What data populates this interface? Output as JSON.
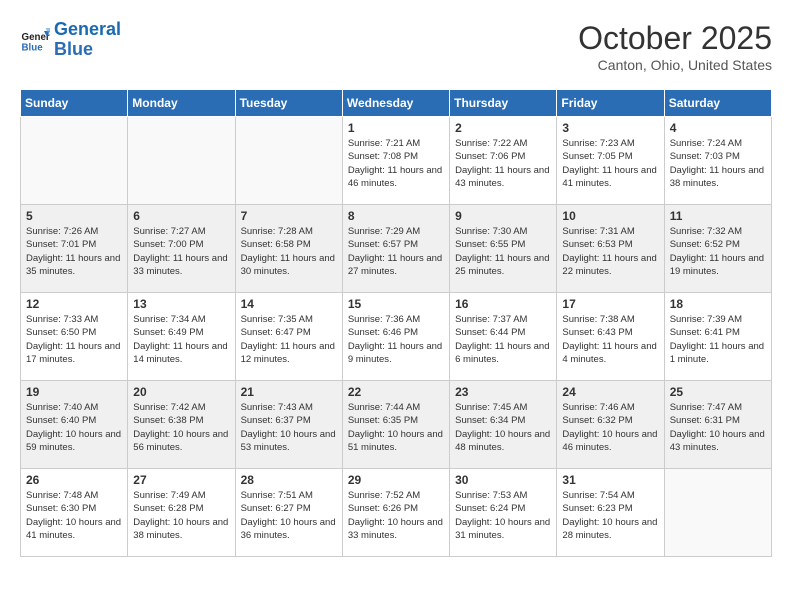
{
  "header": {
    "logo_line1": "General",
    "logo_line2": "Blue",
    "month": "October 2025",
    "location": "Canton, Ohio, United States"
  },
  "days_of_week": [
    "Sunday",
    "Monday",
    "Tuesday",
    "Wednesday",
    "Thursday",
    "Friday",
    "Saturday"
  ],
  "weeks": [
    [
      {
        "day": "",
        "empty": true
      },
      {
        "day": "",
        "empty": true
      },
      {
        "day": "",
        "empty": true
      },
      {
        "day": "1",
        "sunrise": "7:21 AM",
        "sunset": "7:08 PM",
        "daylight": "11 hours and 46 minutes."
      },
      {
        "day": "2",
        "sunrise": "7:22 AM",
        "sunset": "7:06 PM",
        "daylight": "11 hours and 43 minutes."
      },
      {
        "day": "3",
        "sunrise": "7:23 AM",
        "sunset": "7:05 PM",
        "daylight": "11 hours and 41 minutes."
      },
      {
        "day": "4",
        "sunrise": "7:24 AM",
        "sunset": "7:03 PM",
        "daylight": "11 hours and 38 minutes."
      }
    ],
    [
      {
        "day": "5",
        "sunrise": "7:26 AM",
        "sunset": "7:01 PM",
        "daylight": "11 hours and 35 minutes."
      },
      {
        "day": "6",
        "sunrise": "7:27 AM",
        "sunset": "7:00 PM",
        "daylight": "11 hours and 33 minutes."
      },
      {
        "day": "7",
        "sunrise": "7:28 AM",
        "sunset": "6:58 PM",
        "daylight": "11 hours and 30 minutes."
      },
      {
        "day": "8",
        "sunrise": "7:29 AM",
        "sunset": "6:57 PM",
        "daylight": "11 hours and 27 minutes."
      },
      {
        "day": "9",
        "sunrise": "7:30 AM",
        "sunset": "6:55 PM",
        "daylight": "11 hours and 25 minutes."
      },
      {
        "day": "10",
        "sunrise": "7:31 AM",
        "sunset": "6:53 PM",
        "daylight": "11 hours and 22 minutes."
      },
      {
        "day": "11",
        "sunrise": "7:32 AM",
        "sunset": "6:52 PM",
        "daylight": "11 hours and 19 minutes."
      }
    ],
    [
      {
        "day": "12",
        "sunrise": "7:33 AM",
        "sunset": "6:50 PM",
        "daylight": "11 hours and 17 minutes."
      },
      {
        "day": "13",
        "sunrise": "7:34 AM",
        "sunset": "6:49 PM",
        "daylight": "11 hours and 14 minutes."
      },
      {
        "day": "14",
        "sunrise": "7:35 AM",
        "sunset": "6:47 PM",
        "daylight": "11 hours and 12 minutes."
      },
      {
        "day": "15",
        "sunrise": "7:36 AM",
        "sunset": "6:46 PM",
        "daylight": "11 hours and 9 minutes."
      },
      {
        "day": "16",
        "sunrise": "7:37 AM",
        "sunset": "6:44 PM",
        "daylight": "11 hours and 6 minutes."
      },
      {
        "day": "17",
        "sunrise": "7:38 AM",
        "sunset": "6:43 PM",
        "daylight": "11 hours and 4 minutes."
      },
      {
        "day": "18",
        "sunrise": "7:39 AM",
        "sunset": "6:41 PM",
        "daylight": "11 hours and 1 minute."
      }
    ],
    [
      {
        "day": "19",
        "sunrise": "7:40 AM",
        "sunset": "6:40 PM",
        "daylight": "10 hours and 59 minutes."
      },
      {
        "day": "20",
        "sunrise": "7:42 AM",
        "sunset": "6:38 PM",
        "daylight": "10 hours and 56 minutes."
      },
      {
        "day": "21",
        "sunrise": "7:43 AM",
        "sunset": "6:37 PM",
        "daylight": "10 hours and 53 minutes."
      },
      {
        "day": "22",
        "sunrise": "7:44 AM",
        "sunset": "6:35 PM",
        "daylight": "10 hours and 51 minutes."
      },
      {
        "day": "23",
        "sunrise": "7:45 AM",
        "sunset": "6:34 PM",
        "daylight": "10 hours and 48 minutes."
      },
      {
        "day": "24",
        "sunrise": "7:46 AM",
        "sunset": "6:32 PM",
        "daylight": "10 hours and 46 minutes."
      },
      {
        "day": "25",
        "sunrise": "7:47 AM",
        "sunset": "6:31 PM",
        "daylight": "10 hours and 43 minutes."
      }
    ],
    [
      {
        "day": "26",
        "sunrise": "7:48 AM",
        "sunset": "6:30 PM",
        "daylight": "10 hours and 41 minutes."
      },
      {
        "day": "27",
        "sunrise": "7:49 AM",
        "sunset": "6:28 PM",
        "daylight": "10 hours and 38 minutes."
      },
      {
        "day": "28",
        "sunrise": "7:51 AM",
        "sunset": "6:27 PM",
        "daylight": "10 hours and 36 minutes."
      },
      {
        "day": "29",
        "sunrise": "7:52 AM",
        "sunset": "6:26 PM",
        "daylight": "10 hours and 33 minutes."
      },
      {
        "day": "30",
        "sunrise": "7:53 AM",
        "sunset": "6:24 PM",
        "daylight": "10 hours and 31 minutes."
      },
      {
        "day": "31",
        "sunrise": "7:54 AM",
        "sunset": "6:23 PM",
        "daylight": "10 hours and 28 minutes."
      },
      {
        "day": "",
        "empty": true
      }
    ]
  ]
}
